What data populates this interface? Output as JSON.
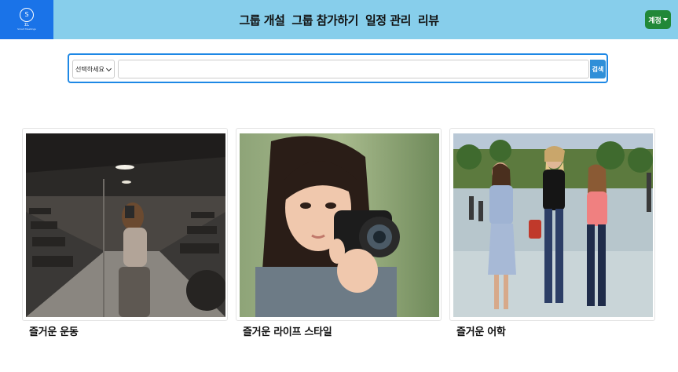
{
  "header": {
    "logo": {
      "mark": "S",
      "text": "ΣL",
      "sub": "Smart Meetings"
    },
    "nav": [
      "그룹 개설",
      "그룹 참가하기",
      "일정 관리",
      "리뷰"
    ],
    "user_button": "계정"
  },
  "search": {
    "select_value": "선택하세요",
    "query_value": "",
    "button_label": "검색"
  },
  "cards": [
    {
      "title": "즐거운 운동",
      "image": "gym-selfie-photo"
    },
    {
      "title": "즐거운 라이프 스타일",
      "image": "camera-girl-photo"
    },
    {
      "title": "즐거운 어학",
      "image": "three-friends-walking-photo"
    }
  ],
  "colors": {
    "header": "#87ceeb",
    "logo_bg": "#1a73e8",
    "user_btn": "#218838",
    "search_border": "#1e88e5"
  }
}
